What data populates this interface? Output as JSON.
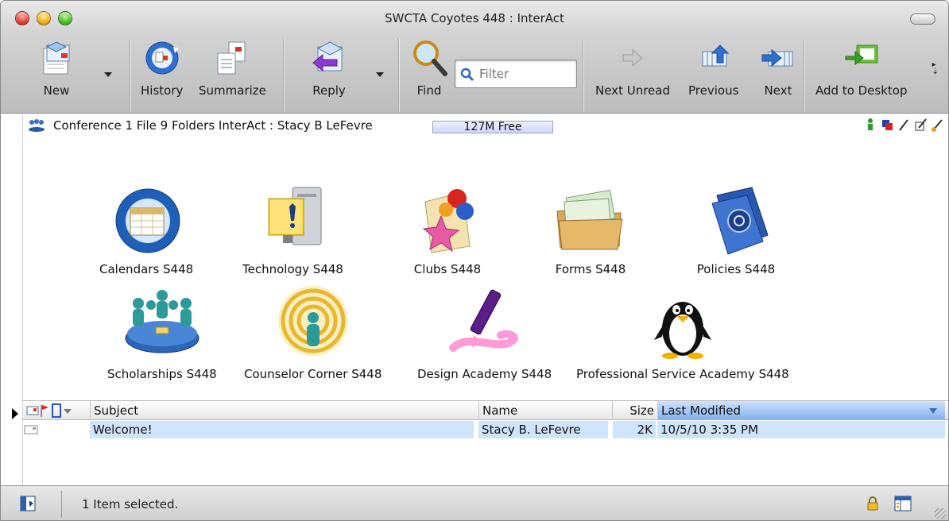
{
  "window": {
    "title": "SWCTA Coyotes 448 : InterAct"
  },
  "toolbar": {
    "new_label": "New",
    "history_label": "History",
    "summarize_label": "Summarize",
    "reply_label": "Reply",
    "find_label": "Find",
    "filter_placeholder": "Filter",
    "next_unread_label": "Next Unread",
    "previous_label": "Previous",
    "next_label": "Next",
    "add_to_desktop_label": "Add to Desktop"
  },
  "pathbar": {
    "text": "Conference   1 File  9 Folders   InterAct : Stacy B LeFevre",
    "free_space": "127M Free"
  },
  "folders": [
    {
      "label": "Calendars S448",
      "icon": "calendar-icon"
    },
    {
      "label": "Technology S448",
      "icon": "computer-icon"
    },
    {
      "label": "Clubs S448",
      "icon": "balloons-icon"
    },
    {
      "label": "Forms S448",
      "icon": "forms-folder-icon"
    },
    {
      "label": "Policies S448",
      "icon": "policies-book-icon"
    },
    {
      "label": "Scholarships S448",
      "icon": "people-group-icon"
    },
    {
      "label": "Counselor Corner S448",
      "icon": "counselor-icon"
    },
    {
      "label": "Design Academy S448",
      "icon": "highlighter-icon"
    },
    {
      "label": "Professional Service Academy S448",
      "icon": "penguin-icon"
    }
  ],
  "table": {
    "columns": {
      "subject": "Subject",
      "name": "Name",
      "size": "Size",
      "last_modified": "Last Modified"
    },
    "rows": [
      {
        "subject": "Welcome!",
        "name": "Stacy B. LeFevre",
        "size": "2K",
        "last_modified": "10/5/10  3:35 PM"
      }
    ]
  },
  "status": {
    "text": "1 Item selected."
  },
  "colors": {
    "selection": "#cfe4fd",
    "sorted_header": "#7fb0ef"
  }
}
